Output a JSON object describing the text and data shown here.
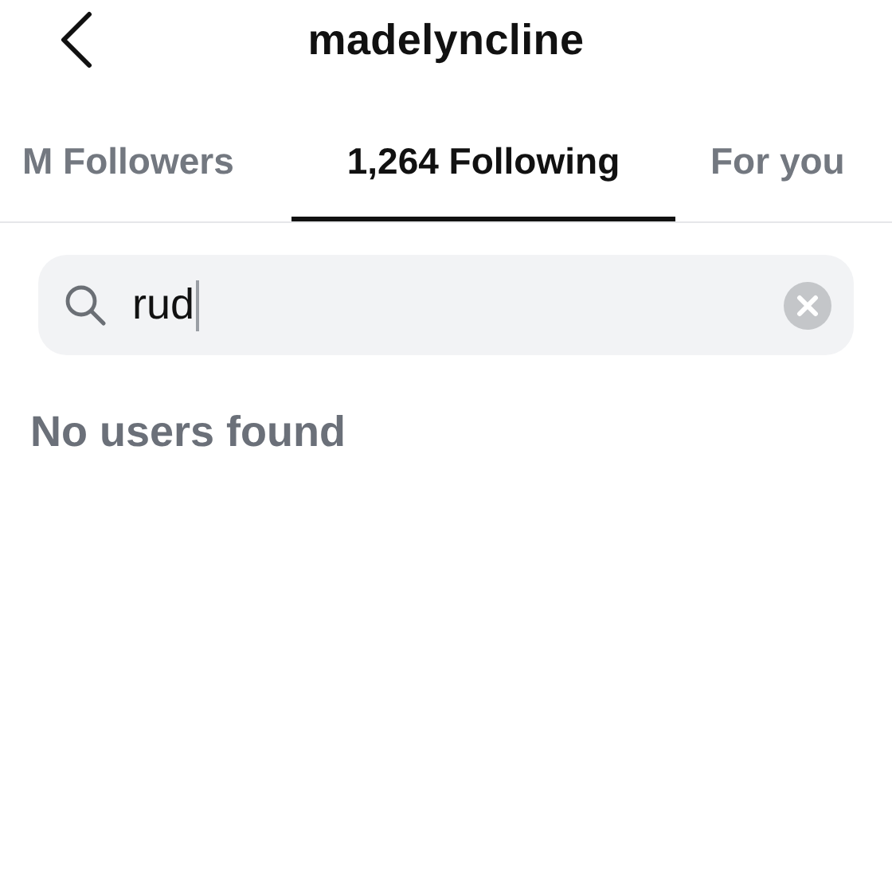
{
  "header": {
    "title": "madelyncline"
  },
  "tabs": [
    {
      "label": "M Followers",
      "selected": false
    },
    {
      "label": "1,264 Following",
      "selected": true
    },
    {
      "label": "For you",
      "selected": false
    }
  ],
  "search": {
    "value": "rud",
    "focused": true
  },
  "results": {
    "message": "No users found"
  }
}
